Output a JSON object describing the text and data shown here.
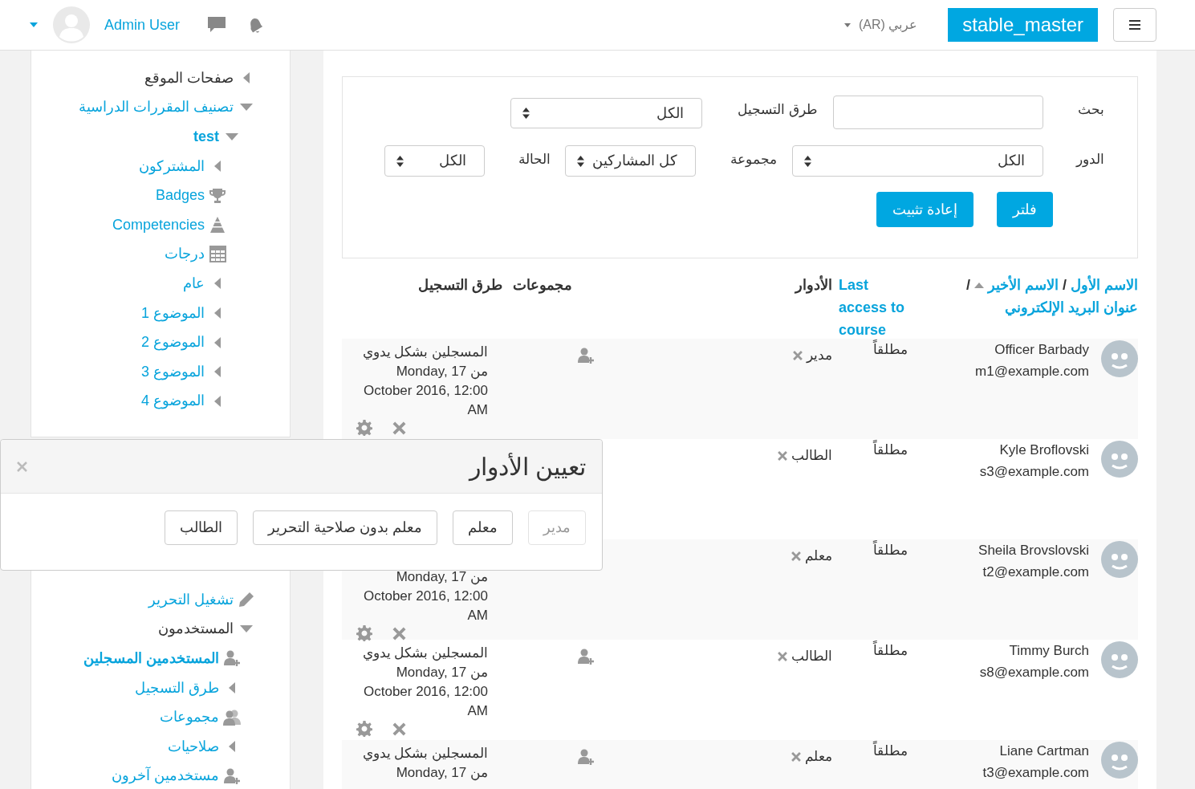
{
  "header": {
    "brand": "stable_master",
    "language": "عربي (AR)",
    "user_name": "Admin User"
  },
  "sidebar": {
    "top_items": [
      {
        "label": "صفحات الموقع",
        "kind": "branch",
        "expanded": false,
        "link": false,
        "active": false
      },
      {
        "label": "تصنيف المقررات الدراسية",
        "kind": "branch",
        "expanded": true,
        "link": true,
        "active": false,
        "children": [
          {
            "label": "test",
            "kind": "branch",
            "expanded": true,
            "link": true,
            "active": true,
            "children": [
              {
                "label": "المشتركون",
                "kind": "branch",
                "expanded": false,
                "link": true,
                "active": false
              },
              {
                "label": "Badges",
                "kind": "badges",
                "link": true,
                "active": false
              },
              {
                "label": "Competencies",
                "kind": "competencies",
                "link": true,
                "active": false
              },
              {
                "label": "درجات",
                "kind": "grades",
                "link": true,
                "active": false
              },
              {
                "label": "عام",
                "kind": "branch",
                "expanded": false,
                "link": true,
                "active": false
              },
              {
                "label": "الموضوع 1",
                "kind": "branch",
                "expanded": false,
                "link": true,
                "active": false
              },
              {
                "label": "الموضوع 2",
                "kind": "branch",
                "expanded": false,
                "link": true,
                "active": false
              },
              {
                "label": "الموضوع 3",
                "kind": "branch",
                "expanded": false,
                "link": true,
                "active": false
              },
              {
                "label": "الموضوع 4",
                "kind": "branch",
                "expanded": false,
                "link": true,
                "active": false
              }
            ]
          }
        ]
      }
    ],
    "bottom_items": [
      {
        "label": "تشغيل التحرير",
        "kind": "editing",
        "link": true,
        "active": false
      },
      {
        "label": "المستخدمون",
        "kind": "branch",
        "expanded": true,
        "link": false,
        "active": false,
        "children": [
          {
            "label": "المستخدمين المسجلين",
            "kind": "enrolled-users",
            "link": true,
            "active": true
          },
          {
            "label": "طرق التسجيل",
            "kind": "branch",
            "expanded": false,
            "link": true,
            "active": false
          },
          {
            "label": "مجموعات",
            "kind": "groups",
            "link": true,
            "active": false
          },
          {
            "label": "صلاحيات",
            "kind": "branch",
            "expanded": false,
            "link": true,
            "active": false
          },
          {
            "label": "مستخدمين آخرون",
            "kind": "other-users",
            "link": true,
            "active": false
          }
        ]
      }
    ]
  },
  "filters": {
    "rows": [
      {
        "fields": [
          {
            "kind": "text",
            "label": "بحث"
          },
          {
            "kind": "select",
            "label": "طرق التسجيل",
            "value": "الكل"
          }
        ]
      },
      {
        "fields": [
          {
            "kind": "select",
            "label": "الدور",
            "value": "الكل"
          },
          {
            "kind": "select",
            "label": "مجموعة",
            "value": "كل المشاركين"
          },
          {
            "kind": "select",
            "label": "الحالة",
            "value": "الكل"
          }
        ]
      }
    ],
    "buttons": [
      "فلتر",
      "إعادة تثبيت"
    ]
  },
  "table": {
    "columns": {
      "first_name": "الاسم الأول",
      "last_name": "الاسم الأخير",
      "last_name_sorted": true,
      "email": "عنوان البريد الإلكتروني",
      "separators": [
        "/",
        "/"
      ],
      "last_access": "Last access to course",
      "roles": "الأدوار",
      "groups": "مجموعات",
      "enrolment": "طرق التسجيل"
    },
    "rows": [
      {
        "name": "Officer Barbady",
        "email": "m1@example.com",
        "last_access": "مطلقاً",
        "roles": [
          "مدير"
        ],
        "enrolment": {
          "method": "المسجلين بشكل يدوي",
          "date": "من Monday, 17 October 2016, 12:00 AM"
        }
      },
      {
        "name": "Kyle Broflovski",
        "email": "s3@example.com",
        "last_access": "مطلقاً",
        "roles": [
          "الطالب"
        ]
      },
      {
        "name": "Sheila Brovslovski",
        "email": "t2@example.com",
        "last_access": "مطلقاً",
        "roles": [
          "معلم"
        ],
        "enrolment": {
          "date": "من Monday, 17 October 2016, 12:00 AM"
        }
      },
      {
        "name": "Timmy Burch",
        "email": "s8@example.com",
        "last_access": "مطلقاً",
        "roles": [
          "الطالب"
        ],
        "enrolment": {
          "method": "المسجلين بشكل يدوي",
          "date": "من Monday, 17 October 2016, 12:00 AM"
        }
      },
      {
        "name": "Liane Cartman",
        "email": "t3@example.com",
        "last_access": "مطلقاً",
        "roles": [
          "معلم"
        ],
        "enrolment": {
          "method": "المسجلين بشكل يدوي",
          "date": "من Monday, 17"
        }
      }
    ]
  },
  "dialog": {
    "title": "تعيين الأدوار",
    "buttons": [
      {
        "label": "مدير",
        "disabled": true
      },
      {
        "label": "معلم",
        "disabled": false
      },
      {
        "label": "معلم بدون صلاحية التحرير",
        "disabled": false
      },
      {
        "label": "الطالب",
        "disabled": false
      }
    ]
  }
}
